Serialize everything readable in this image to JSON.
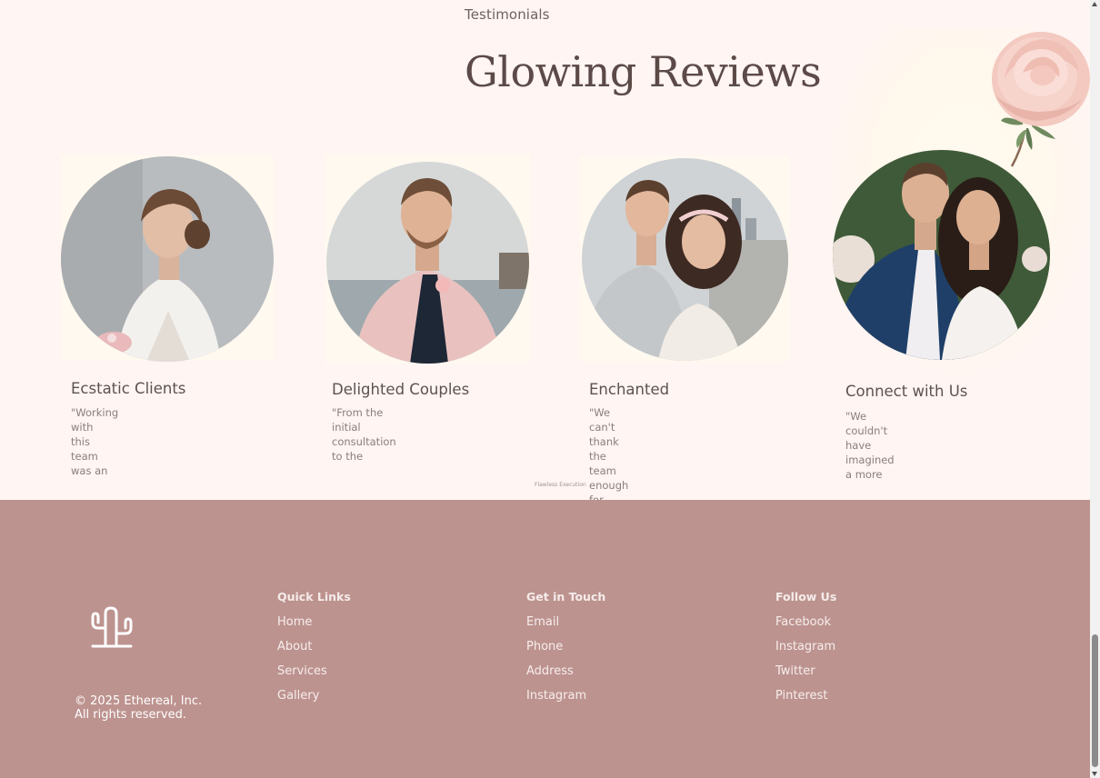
{
  "testimonials": {
    "section_label": "Testimonials",
    "title": "Glowing Reviews",
    "flawless_caption": "Flawless Execution",
    "cards": [
      {
        "title": "Ecstatic Clients",
        "quote": "\"Working with\nthis team was an",
        "photo": "bride-portrait"
      },
      {
        "title": "Delighted Couples",
        "quote": "\"From the initial\nconsultation to the",
        "photo": "groom-portrait"
      },
      {
        "title": "Enchanted",
        "quote": "\"We can't thank the\nteam enough for",
        "photo": "couple-city-portrait"
      },
      {
        "title": "Connect with Us",
        "quote": "\"We couldn't have\nimagined a more",
        "photo": "couple-garden-portrait"
      }
    ]
  },
  "footer": {
    "logo_icon": "cactus-icon",
    "copyright": "© 2025 Ethereal, Inc.\nAll rights reserved.",
    "columns": [
      {
        "heading": "Quick Links",
        "links": [
          "Home",
          "About",
          "Services",
          "Gallery"
        ]
      },
      {
        "heading": "Get in Touch",
        "links": [
          "Email",
          "Phone",
          "Address",
          "Instagram"
        ]
      },
      {
        "heading": "Follow Us",
        "links": [
          "Facebook",
          "Instagram",
          "Twitter",
          "Pinterest"
        ]
      }
    ]
  },
  "colors": {
    "page_background": "#fff5f3",
    "footer_background": "#bd938f",
    "title_text": "#5b4a47"
  }
}
